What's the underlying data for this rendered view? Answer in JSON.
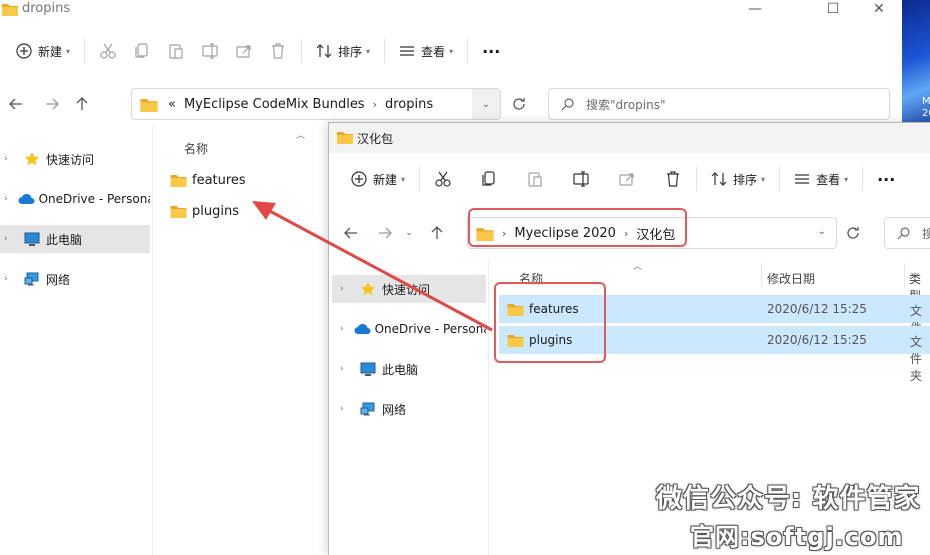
{
  "desktop": {
    "text": "M\n20"
  },
  "window_back": {
    "title": "dropins",
    "controls": {
      "minimize": "—",
      "maximize": "☐",
      "close": "✕"
    },
    "commands": {
      "new_label": "新建",
      "sort_label": "排序",
      "view_label": "查看",
      "more_label": "···"
    },
    "address": {
      "overflow": "«",
      "crumbs": [
        "MyEclipse CodeMix Bundles",
        "dropins"
      ]
    },
    "search_placeholder": "搜索\"dropins\"",
    "sidebar": [
      {
        "label": "快速访问",
        "icon": "star-icon"
      },
      {
        "label": "OneDrive - Personal",
        "icon": "cloud-icon"
      },
      {
        "label": "此电脑",
        "icon": "computer-icon"
      },
      {
        "label": "网络",
        "icon": "network-icon"
      }
    ],
    "column_name": "名称",
    "files": [
      {
        "name": "features"
      },
      {
        "name": "plugins"
      }
    ]
  },
  "window_front": {
    "title": "汉化包",
    "commands": {
      "new_label": "新建",
      "sort_label": "排序",
      "view_label": "查看",
      "more_label": "···"
    },
    "address": {
      "crumbs": [
        "Myeclipse 2020",
        "汉化包"
      ]
    },
    "search_placeholder": "搜",
    "sidebar": [
      {
        "label": "快速访问",
        "icon": "star-icon"
      },
      {
        "label": "OneDrive - Personal",
        "icon": "cloud-icon"
      },
      {
        "label": "此电脑",
        "icon": "computer-icon"
      },
      {
        "label": "网络",
        "icon": "network-icon"
      }
    ],
    "columns": {
      "name": "名称",
      "date": "修改日期",
      "type": "类型"
    },
    "files": [
      {
        "name": "features",
        "date": "2020/6/12 15:25",
        "type": "文件夹"
      },
      {
        "name": "plugins",
        "date": "2020/6/12 15:25",
        "type": "文件夹"
      }
    ]
  },
  "watermark": {
    "line1": "微信公众号: 软件管家",
    "line2": "官网:softgj.com"
  },
  "colors": {
    "highlight_red": "#e05a5a",
    "selection_blue": "#cce8ff",
    "folder_yellow": "#f8c846"
  }
}
